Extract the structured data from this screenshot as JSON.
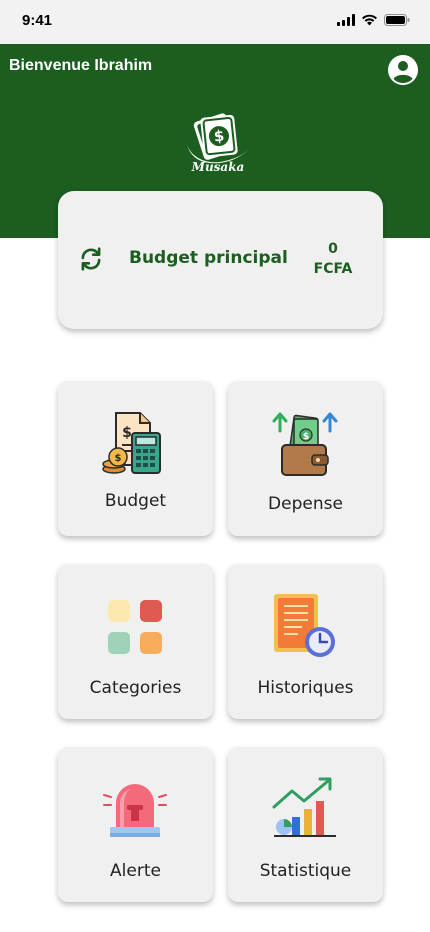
{
  "status_bar": {
    "time": "9:41"
  },
  "header": {
    "greeting": "Bienvenue Ibrahim",
    "brand": "Musaka",
    "background_color": "#1b5e20"
  },
  "budget_card": {
    "title": "Budget principal",
    "amount": "0",
    "currency": "FCFA"
  },
  "menu": [
    {
      "label": "Budget",
      "icon": "budget-calculator-icon"
    },
    {
      "label": "Depense",
      "icon": "wallet-money-icon"
    },
    {
      "label": "Categories",
      "icon": "categories-grid-icon"
    },
    {
      "label": "Historiques",
      "icon": "history-clock-icon"
    },
    {
      "label": "Alerte",
      "icon": "siren-alert-icon"
    },
    {
      "label": "Statistique",
      "icon": "statistics-chart-icon"
    }
  ]
}
